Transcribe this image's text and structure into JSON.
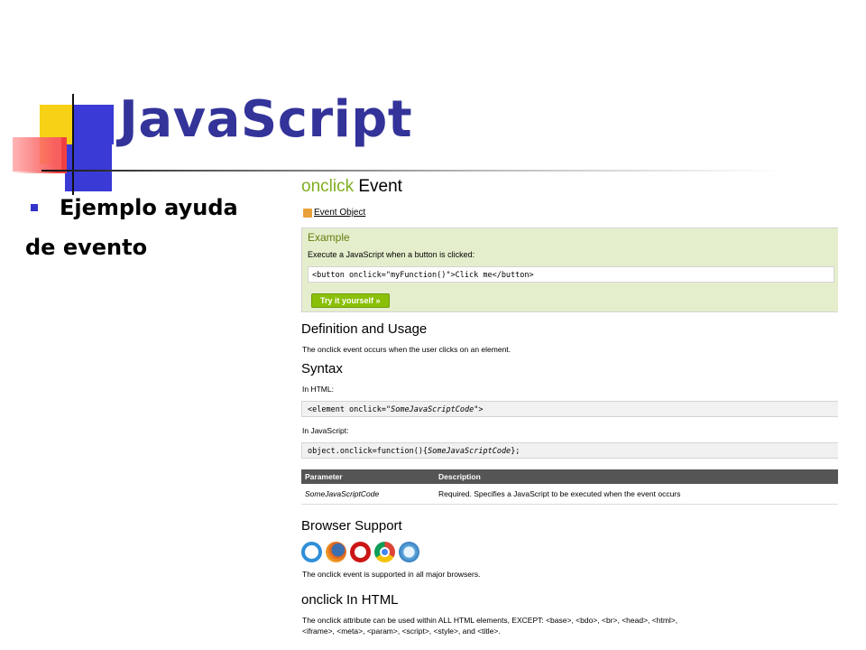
{
  "slide": {
    "title": "JavaScript",
    "bullet_line1": "Ejemplo ayuda",
    "bullet_line2": "de evento",
    "accent_colors": {
      "title": "#33339a",
      "yellow": "#f7d116",
      "blue": "#3a3ad6",
      "red": "#f04040"
    }
  },
  "screenshot": {
    "heading_keyword": "onclick",
    "heading_rest": " Event",
    "event_object_link": "Event Object",
    "example": {
      "title": "Example",
      "description": "Execute a JavaScript when a button is clicked:",
      "code": "<button onclick=\"myFunction()\">Click me</button>",
      "try_button": "Try it yourself »"
    },
    "definition": {
      "heading": "Definition and Usage",
      "text": "The onclick event occurs when the user clicks on an element."
    },
    "syntax": {
      "heading": "Syntax",
      "html_label": "In HTML:",
      "html_code_prefix": "<element onclick=\"",
      "html_code_italic": "SomeJavaScriptCode",
      "html_code_suffix": "\">",
      "js_label": "In JavaScript:",
      "js_code_prefix": "object.onclick=function(){",
      "js_code_italic": "SomeJavaScriptCode",
      "js_code_suffix": "};"
    },
    "table": {
      "headers": [
        "Parameter",
        "Description"
      ],
      "rows": [
        [
          "SomeJavaScriptCode",
          "Required. Specifies a JavaScript to be executed when the event occurs"
        ]
      ]
    },
    "browser_support": {
      "heading": "Browser Support",
      "icons": [
        "internet-explorer-icon",
        "firefox-icon",
        "opera-icon",
        "chrome-icon",
        "safari-icon"
      ],
      "text": "The onclick event is supported in all major browsers."
    },
    "onclick_html": {
      "heading": "onclick In HTML",
      "text_line1": "The onclick attribute can be used within ALL HTML elements, EXCEPT: <base>, <bdo>, <br>, <head>, <html>,",
      "text_line2": "<iframe>, <meta>, <param>, <script>, <style>, and <title>."
    }
  }
}
